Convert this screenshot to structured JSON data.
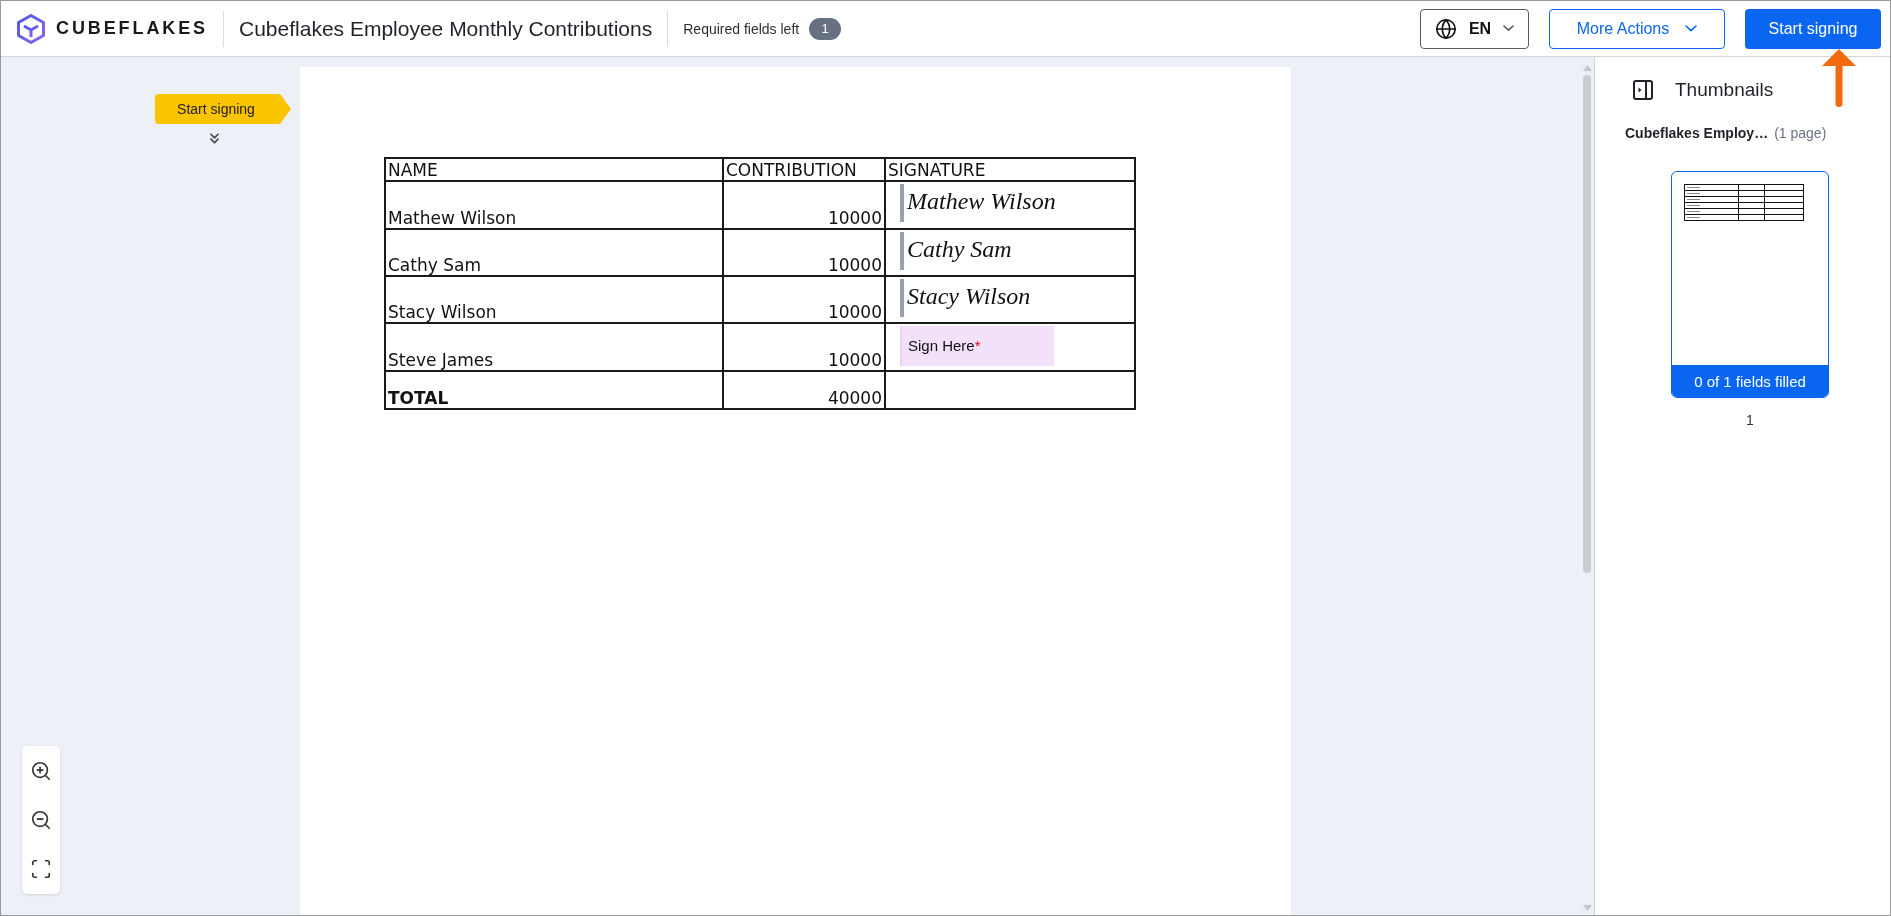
{
  "header": {
    "logo_text": "CUBEFLAKES",
    "document_title": "Cubeflakes Employee Monthly Contributions",
    "required_fields": {
      "label": "Required fields left",
      "count": "1"
    },
    "language_button": "EN",
    "more_actions_button": "More Actions",
    "start_button": "Start signing"
  },
  "navigator": {
    "tag": "Start signing"
  },
  "document": {
    "table": {
      "columns": [
        "NAME",
        "CONTRIBUTION",
        "SIGNATURE"
      ],
      "rows": [
        {
          "name": "Mathew Wilson",
          "contribution": "10000",
          "signature": {
            "kind": "signed",
            "text": "Mathew Wilson"
          }
        },
        {
          "name": "Cathy Sam",
          "contribution": "10000",
          "signature": {
            "kind": "signed",
            "text": "Cathy Sam"
          }
        },
        {
          "name": "Stacy Wilson",
          "contribution": "10000",
          "signature": {
            "kind": "signed",
            "text": "Stacy Wilson"
          }
        },
        {
          "name": "Steve James",
          "contribution": "10000",
          "signature": {
            "kind": "field",
            "label": "Sign Here",
            "marker": "*"
          }
        }
      ],
      "total": {
        "label": "TOTAL",
        "value": "40000"
      }
    }
  },
  "thumbnails": {
    "title": "Thumbnails",
    "document_name": "Cubeflakes Employ…",
    "page_count": "(1 page)",
    "pages": [
      {
        "status": "0 of 1 fields filled",
        "number": "1",
        "selected": true
      }
    ]
  }
}
